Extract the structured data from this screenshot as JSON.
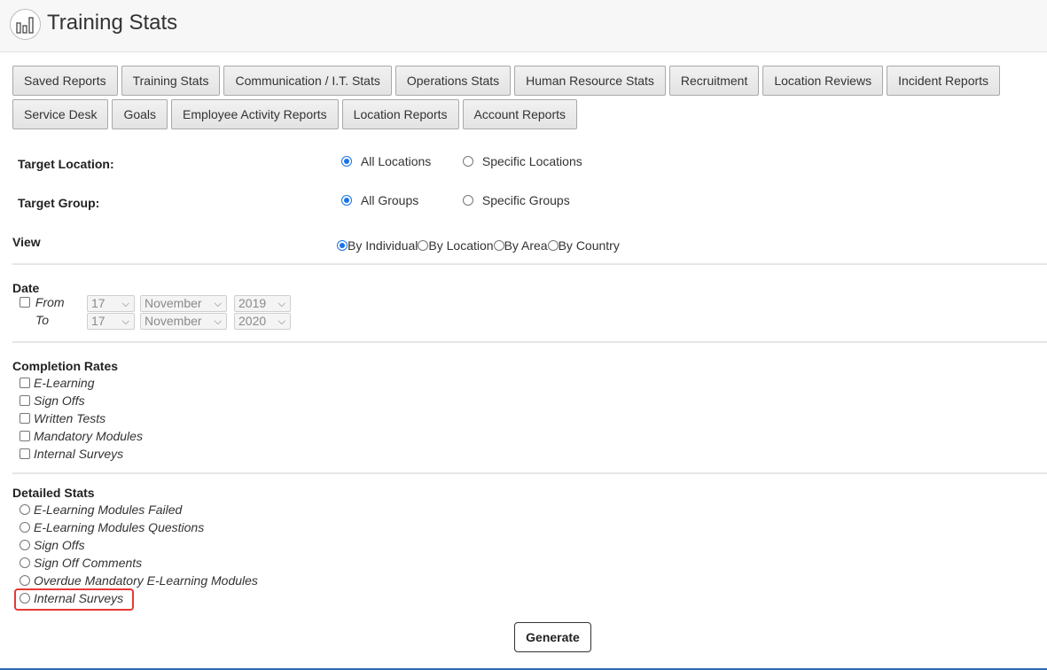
{
  "header": {
    "title": "Training Stats",
    "logo_icon": "bar-chart-icon"
  },
  "tabs": {
    "row1": [
      "Saved Reports",
      "Training Stats",
      "Communication / I.T. Stats",
      "Operations Stats",
      "Human Resource Stats",
      "Recruitment",
      "Location Reviews",
      "Incident Reports"
    ],
    "row2": [
      "Service Desk",
      "Goals",
      "Employee Activity Reports",
      "Location Reports",
      "Account Reports"
    ]
  },
  "target_location": {
    "label": "Target Location:",
    "options": [
      "All Locations",
      "Specific Locations"
    ],
    "selected": "All Locations"
  },
  "target_group": {
    "label": "Target Group:",
    "options": [
      "All Groups",
      "Specific Groups"
    ],
    "selected": "All Groups"
  },
  "view": {
    "label": "View",
    "options": [
      "By Individual",
      "By Location",
      "By Area",
      "By Country"
    ],
    "selected": "By Individual"
  },
  "date": {
    "label": "Date",
    "from_label": "From",
    "to_label": "To",
    "from": {
      "day": "17",
      "month": "November",
      "year": "2019"
    },
    "to": {
      "day": "17",
      "month": "November",
      "year": "2020"
    }
  },
  "completion_rates": {
    "label": "Completion Rates",
    "items": [
      "E-Learning",
      "Sign Offs",
      "Written Tests",
      "Mandatory Modules",
      "Internal Surveys"
    ]
  },
  "detailed_stats": {
    "label": "Detailed Stats",
    "items": [
      "E-Learning Modules Failed",
      "E-Learning Modules Questions",
      "Sign Offs",
      "Sign Off Comments",
      "Overdue Mandatory E-Learning Modules",
      "Internal Surveys"
    ],
    "highlighted": "Internal Surveys"
  },
  "generate_label": "Generate",
  "colors": {
    "accent": "#1a73e8",
    "highlight": "#e53935"
  }
}
